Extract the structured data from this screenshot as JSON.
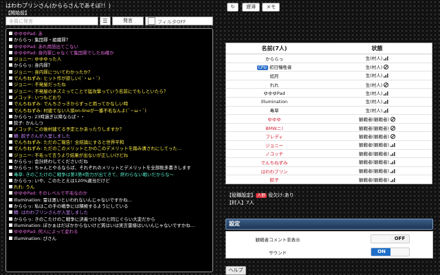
{
  "title": "はわわプリンさん(かららさんであそぼ!！)",
  "subtitle": "【開始前】",
  "speech_input": {
    "placeholder": "全員に発言"
  },
  "menu_icon": "hamburger-icon",
  "send_label": "発言",
  "filter": {
    "value": "フィルタOFF"
  },
  "top_buttons": {
    "refresh_icon": "refresh-icon",
    "delay": "遅滞",
    "memo": "メモ"
  },
  "log": [
    {
      "text": "ゆゆゆPad: あ",
      "color": "#e86de0"
    },
    {
      "text": "かららっ: 集団罪・組織罪？",
      "color": "#ffffff"
    },
    {
      "text": "ゆゆゆPad: あれ用語出てこない",
      "color": "#e86de0"
    },
    {
      "text": "ゆゆゆPad: 身内罪じゃなくて集団罪でしたね確か",
      "color": "#e86de0"
    },
    {
      "text": "ジョニー: ゆゆゆった人",
      "color": "#ffee44"
    },
    {
      "text": "かららっ: 身内罪？",
      "color": "#ffffff"
    },
    {
      "text": "ジョニー: 身内罪についてわかったか？",
      "color": "#ffee44"
    },
    {
      "text": "でんちねずみ: ヒット作が欲しい(´・ω・`)",
      "color": "#ffee44"
    },
    {
      "text": "ジョニー: 不発屋だったね",
      "color": "#ffee44"
    },
    {
      "text": "ジョニー: 不発屋のネズミってことで猛攻撃っていう名前にでもしといたら？",
      "color": "#ffee44"
    },
    {
      "text": "ノコッチ: いつもどおり",
      "color": "#ffee44"
    },
    {
      "text": "でんちねずみ: でんちさっきからずっと雨ってかなしい時",
      "color": "#ffee44"
    },
    {
      "text": "でんちねずみ: 村建てない人狼on-lineが一番不毛なんよ(´・ω・`)",
      "color": "#ffee44"
    },
    {
      "text": "かららっ: 23時過ぎ以降ならば・・",
      "color": "#ffffff"
    },
    {
      "text": "餃子: かんしつ",
      "color": "#ffffff"
    },
    {
      "text": "ノコッチ: この後村建てる予定とかあったりしますか？",
      "color": "#ffee44"
    },
    {
      "text": "鯖: 餃子さんが入室しました",
      "color": "#cc88ff"
    },
    {
      "text": "でんちねずみ: ただのご報告！全結論にすると世界平和",
      "color": "#ffee44"
    },
    {
      "text": "でんちねずみ: ただのこのメリットとかのこのデメリットを踏み潰されにしてった…",
      "color": "#ffee44"
    },
    {
      "text": "ジョニー: 不毛って言うより結果が出ないが正しいけどね",
      "color": "#ffee44"
    },
    {
      "text": "かららっ: 会計終わしてくださいだね",
      "color": "#ffffff"
    },
    {
      "text": "かららっ: ちゃんとやるならば、それぞれのメリットとデメリットを全部既多書きします",
      "color": "#ffffff"
    },
    {
      "text": "毒草: きのこたけのこ戦争は第3第4勢力が出てきて、終わらない戦いだからな〜",
      "color": "#55eecc"
    },
    {
      "text": "かららっ: いや、このたとえは120%適当だけど",
      "color": "#ffffff"
    },
    {
      "text": "れれ: うん",
      "color": "#ffee44"
    },
    {
      "text": "ゆゆゆPad: そのレベルで不毛なのか",
      "color": "#e86de0"
    },
    {
      "text": "Illumination: 霊は悪いといわれないんじゃないですかね…",
      "color": "#ffffff"
    },
    {
      "text": "かららっ: 私はこの手の戦争には積極するようにしている",
      "color": "#ffffff"
    },
    {
      "text": "鯖: はわわプリンさんが入室しました",
      "color": "#cc88ff"
    },
    {
      "text": "かららっ: きのこたけのこ戦争に決着つけるのと同じぐらい大変だから",
      "color": "#ffffff"
    },
    {
      "text": "Illumination: ぼかぁはだぼかからないけど質はいは実言霊様はいいんじゃないですかね…",
      "color": "#ffffff"
    },
    {
      "text": "ゆゆゆPad: 何人によって変わる",
      "color": "#e86de0"
    },
    {
      "text": "Illumination: ぴさん",
      "color": "#ffffff"
    }
  ],
  "players": {
    "header_name": "名前(7人)",
    "header_status": "状態",
    "rows": [
      {
        "name": "かららっ",
        "status": "生(村人)",
        "icon": "signal-icon",
        "red": false,
        "badge": ""
      },
      {
        "name": "初日犠牲者",
        "status": "生(村人)",
        "icon": "no-signal-icon",
        "red": false,
        "badge": "CPU"
      },
      {
        "name": "如月",
        "status": "生(村人)",
        "icon": "signal-icon",
        "red": false,
        "badge": ""
      },
      {
        "name": "れれ",
        "status": "生(村人)",
        "icon": "no-signal-icon",
        "red": false,
        "badge": ""
      },
      {
        "name": "ゆゆゆPad",
        "status": "生(村人)",
        "icon": "signal-icon",
        "red": false,
        "badge": ""
      },
      {
        "name": "Illumination",
        "status": "生(村人)",
        "icon": "signal-icon",
        "red": false,
        "badge": ""
      },
      {
        "name": "毒草",
        "status": "生(村人)",
        "icon": "signal-icon",
        "red": false,
        "badge": ""
      },
      {
        "name": "ゆゆゆ",
        "status": "観戦者(観戦者)",
        "icon": "no-signal-icon",
        "red": true,
        "badge": ""
      },
      {
        "name": "BMWニ!",
        "status": "観戦者(観戦者)",
        "icon": "no-signal-icon",
        "red": true,
        "badge": ""
      },
      {
        "name": "フレディ",
        "status": "観戦者(観戦者)",
        "icon": "no-signal-icon",
        "red": true,
        "badge": ""
      },
      {
        "name": "ジョニー",
        "status": "観戦者(観戦者)",
        "icon": "signal-icon",
        "red": true,
        "badge": ""
      },
      {
        "name": "ノコッチ",
        "status": "観戦者(観戦者)",
        "icon": "signal-icon",
        "red": true,
        "badge": ""
      },
      {
        "name": "でんちねずみ",
        "status": "観戦者(観戦者)",
        "icon": "signal-icon",
        "red": true,
        "badge": ""
      },
      {
        "name": "はわわプリン",
        "status": "観戦者(観戦者)",
        "icon": "signal-icon",
        "red": true,
        "badge": ""
      },
      {
        "name": "餃子",
        "status": "観戦者(観戦者)",
        "icon": "signal-icon",
        "red": true,
        "badge": ""
      }
    ]
  },
  "setup": {
    "label": "【役職設定】",
    "ribbon": "人狼",
    "rest": "役欠け:あり"
  },
  "village": "【村人】7人",
  "settings": {
    "header": "設定",
    "spectator_comment_label": "観戦者コメント非表示",
    "spectator_comment_state": "OFF",
    "sound_label": "サウンド",
    "sound_state": "ON"
  },
  "help_label": "ヘルプ"
}
